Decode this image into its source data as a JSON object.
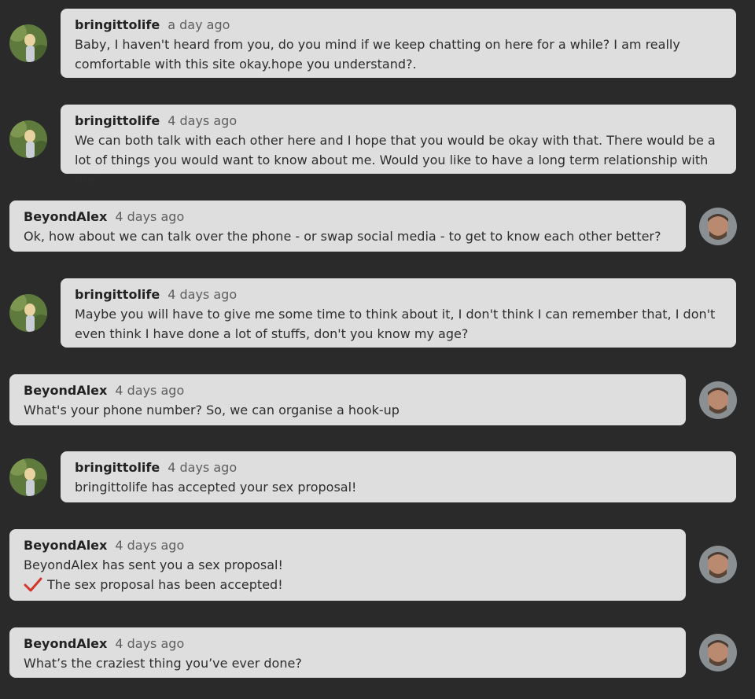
{
  "colors": {
    "background": "#2a2a2a",
    "bubble": "#dedede",
    "check": "#d2362a"
  },
  "messages": [
    {
      "author": "bringittolife",
      "time": "a day ago",
      "text": "Baby, I haven't heard from you, do you mind if we keep chatting on here for a while? I am really comfortable with this site okay.hope you understand?."
    },
    {
      "author": "bringittolife",
      "time": "4 days ago",
      "text": "We can both talk with each other here and I hope that you would be okay with that. There would be a lot of things you would want to know about me. Would you like to have a long term relationship with me?"
    },
    {
      "author": "BeyondAlex",
      "time": "4 days ago",
      "text": "Ok, how about we can talk over the phone - or swap social media - to get to know each other better?"
    },
    {
      "author": "bringittolife",
      "time": "4 days ago",
      "text": "Maybe you will have to give me some time to think about it, I don't think I can remember that, I don't even think I have done a lot of stuffs, don't you know my age?"
    },
    {
      "author": "BeyondAlex",
      "time": "4 days ago",
      "text": "What's your phone number? So, we can organise a hook-up"
    },
    {
      "author": "bringittolife",
      "time": "4 days ago",
      "text": "bringittolife has accepted your sex proposal!"
    },
    {
      "author": "BeyondAlex",
      "time": "4 days ago",
      "text": "BeyondAlex has sent you a sex proposal!",
      "status_icon": "check-icon",
      "status_text": "The sex proposal has been accepted!"
    },
    {
      "author": "BeyondAlex",
      "time": "4 days ago",
      "text": "What’s the craziest thing you’ve ever done?"
    }
  ]
}
